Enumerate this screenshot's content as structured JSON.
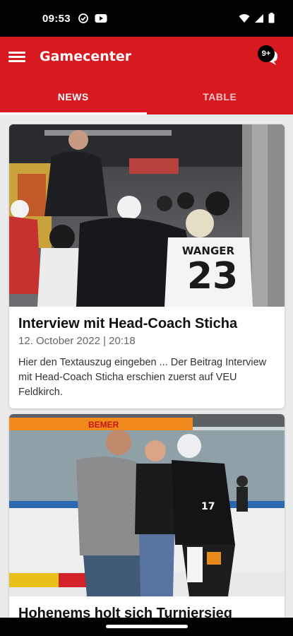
{
  "status_bar": {
    "time": "09:53"
  },
  "app_bar": {
    "title": "Gamecenter",
    "chat_badge": "9+",
    "brand_color": "#d71920"
  },
  "tabs": [
    {
      "label": "NEWS",
      "active": true
    },
    {
      "label": "TABLE",
      "active": false
    }
  ],
  "articles": [
    {
      "title": "Interview mit Head-Coach Sticha",
      "date": "12. October 2022 | 20:18",
      "excerpt": "Hier den Textauszug eingeben ... Der Beitrag Interview mit Head-Coach Sticha erschien zuerst auf VEU Feldkirch.",
      "jersey_name": "WANGER",
      "jersey_number": "23"
    },
    {
      "title": "Hohenems holt sich Turniersieg",
      "board_text": "BEMER",
      "jersey_number": "17"
    }
  ]
}
